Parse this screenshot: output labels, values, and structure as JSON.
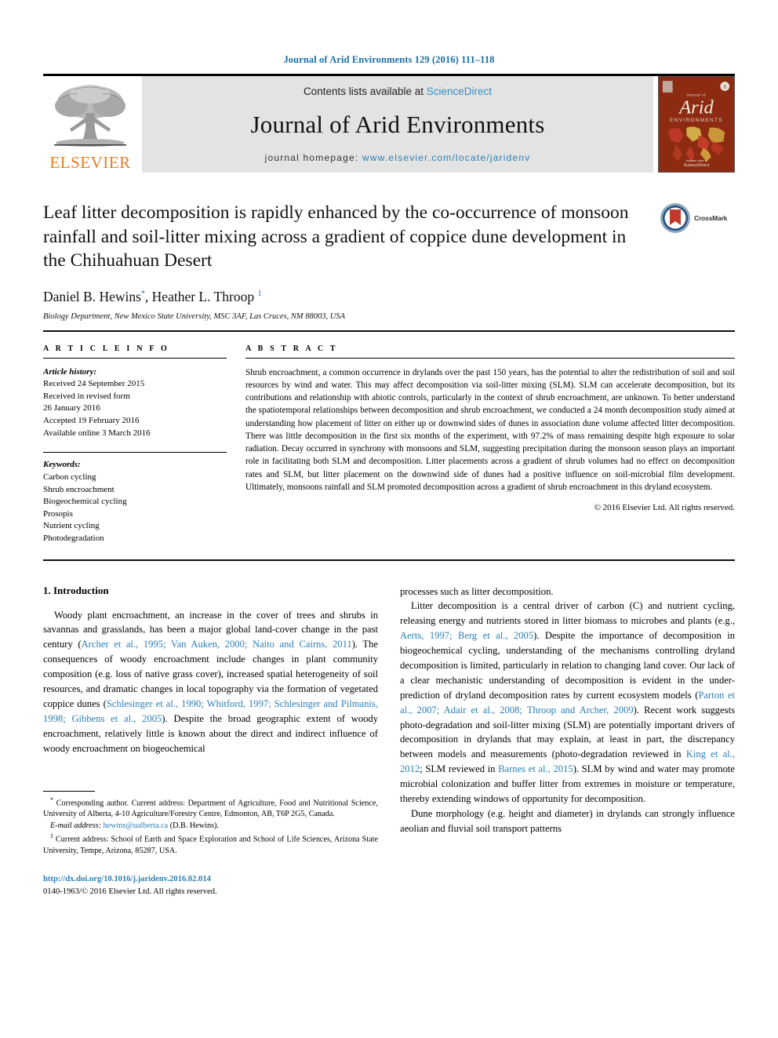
{
  "running_head": "Journal of Arid Environments 129 (2016) 111–118",
  "masthead": {
    "publisher_logo_text": "ELSEVIER",
    "contents_prefix": "Contents lists available at ",
    "contents_link": "ScienceDirect",
    "journal_name": "Journal of Arid Environments",
    "homepage_prefix": "journal homepage: ",
    "homepage_url": "www.elsevier.com/locate/jaridenv",
    "cover_journal_label_small": "Journal of",
    "cover_journal_label_main": "Arid",
    "cover_journal_label_sub": "ENVIRONMENTS",
    "cover_footer": "ScienceDirect"
  },
  "article": {
    "title": "Leaf litter decomposition is rapidly enhanced by the co-occurrence of monsoon rainfall and soil-litter mixing across a gradient of coppice dune development in the Chihuahuan Desert",
    "crossmark_label": "CrossMark",
    "authors_plain": "Daniel B. Hewins",
    "author1": "Daniel B. Hewins",
    "author1_marker": "*",
    "author_separator": ", ",
    "author2": "Heather L. Throop",
    "author2_marker": "1",
    "affiliation": "Biology Department, New Mexico State University, MSC 3AF, Las Cruces, NM 88003, USA"
  },
  "article_info": {
    "heading": "A R T I C L E   I N F O",
    "history_label": "Article history:",
    "history": [
      "Received 24 September 2015",
      "Received in revised form",
      "26 January 2016",
      "Accepted 19 February 2016",
      "Available online 3 March 2016"
    ],
    "keywords_label": "Keywords:",
    "keywords": [
      "Carbon cycling",
      "Shrub encroachment",
      "Biogeochemical cycling",
      "Prosopis",
      "Nutrient cycling",
      "Photodegradation"
    ]
  },
  "abstract": {
    "heading": "A B S T R A C T",
    "text": "Shrub encroachment, a common occurrence in drylands over the past 150 years, has the potential to alter the redistribution of soil and soil resources by wind and water. This may affect decomposition via soil-litter mixing (SLM). SLM can accelerate decomposition, but its contributions and relationship with abiotic controls, particularly in the context of shrub encroachment, are unknown. To better understand the spatiotemporal relationships between decomposition and shrub encroachment, we conducted a 24 month decomposition study aimed at understanding how placement of litter on either up or downwind sides of dunes in association dune volume affected litter decomposition. There was little decomposition in the first six months of the experiment, with 97.2% of mass remaining despite high exposure to solar radiation. Decay occurred in synchrony with monsoons and SLM, suggesting precipitation during the monsoon season plays an important role in facilitating both SLM and decomposition. Litter placements across a gradient of shrub volumes had no effect on decomposition rates and SLM, but litter placement on the downwind side of dunes had a positive influence on soil-microbial film development. Ultimately, monsoons rainfall and SLM promoted decomposition across a gradient of shrub encroachment in this dryland ecosystem.",
    "copyright": "© 2016 Elsevier Ltd. All rights reserved."
  },
  "body": {
    "section1_title": "1.  Introduction",
    "left_para1_pre": "Woody plant encroachment, an increase in the cover of trees and shrubs in savannas and grasslands, has been a major global land-cover change in the past century (",
    "left_para1_ref1": "Archer et al., 1995; Van Auken, 2000; Naito and Cairns, 2011",
    "left_para1_mid": "). The consequences of woody encroachment include changes in plant community composition (e.g. loss of native grass cover), increased spatial heterogeneity of soil resources, and dramatic changes in local topography via the formation of vegetated coppice dunes (",
    "left_para1_ref2": "Schlesinger et al., 1990; Whitford, 1997; Schlesinger and Pilmanis, 1998; Gibbens et al., 2005",
    "left_para1_post": "). Despite the broad geographic extent of woody encroachment, relatively little is known about the direct and indirect influence of woody encroachment on biogeochemical",
    "right_para0": "processes such as litter decomposition.",
    "right_para1_pre": "Litter decomposition is a central driver of carbon (C) and nutrient cycling, releasing energy and nutrients stored in litter biomass to microbes and plants (e.g., ",
    "right_para1_ref1": "Aerts, 1997; Berg et al., 2005",
    "right_para1_mid1": "). Despite the importance of decomposition in biogeochemical cycling, understanding of the mechanisms controlling dryland decomposition is limited, particularly in relation to changing land cover. Our lack of a clear mechanistic understanding of decomposition is evident in the under-prediction of dryland decomposition rates by current ecosystem models (",
    "right_para1_ref2": "Parton et al., 2007; Adair et al., 2008; Throop and Archer, 2009",
    "right_para1_mid2": "). Recent work suggests photo-degradation and soil-litter mixing (SLM) are potentially important drivers of decomposition in drylands that may explain, at least in part, the discrepancy between models and measurements (photo-degradation reviewed in ",
    "right_para1_ref3": "King et al., 2012",
    "right_para1_mid3": "; SLM reviewed in ",
    "right_para1_ref4": "Barnes et al., 2015",
    "right_para1_post": "). SLM by wind and water may promote microbial colonization and buffer litter from extremes in moisture or temperature, thereby extending windows of opportunity for decomposition.",
    "right_para2": "Dune morphology (e.g. height and diameter) in drylands can strongly influence aeolian and fluvial soil transport patterns"
  },
  "footnotes": {
    "corresponding_marker": "*",
    "corresponding_text": " Corresponding author. Current address: Department of Agriculture, Food and Nutritional Science, University of Alberta, 4-10 Agriculture/Forestry Centre, Edmonton, AB, T6P 2G5, Canada.",
    "email_label": "E-mail address:",
    "email": "hewins@ualberta.ca",
    "email_owner": " (D.B. Hewins).",
    "note1_marker": "1",
    "note1_text": " Current address: School of Earth and Space Exploration and School of Life Sciences, Arizona State University, Tempe, Arizona, 85287, USA.",
    "doi": "http://dx.doi.org/10.1016/j.jaridenv.2016.02.014",
    "issn_line": "0140-1963/© 2016 Elsevier Ltd. All rights reserved."
  },
  "colors": {
    "link_blue": "#2a7fb5",
    "running_head_blue": "#1a6fa8",
    "elsevier_orange": "#E87D1E",
    "masthead_gray": "#e3e3e3",
    "cover_red": "#8d2b12"
  }
}
